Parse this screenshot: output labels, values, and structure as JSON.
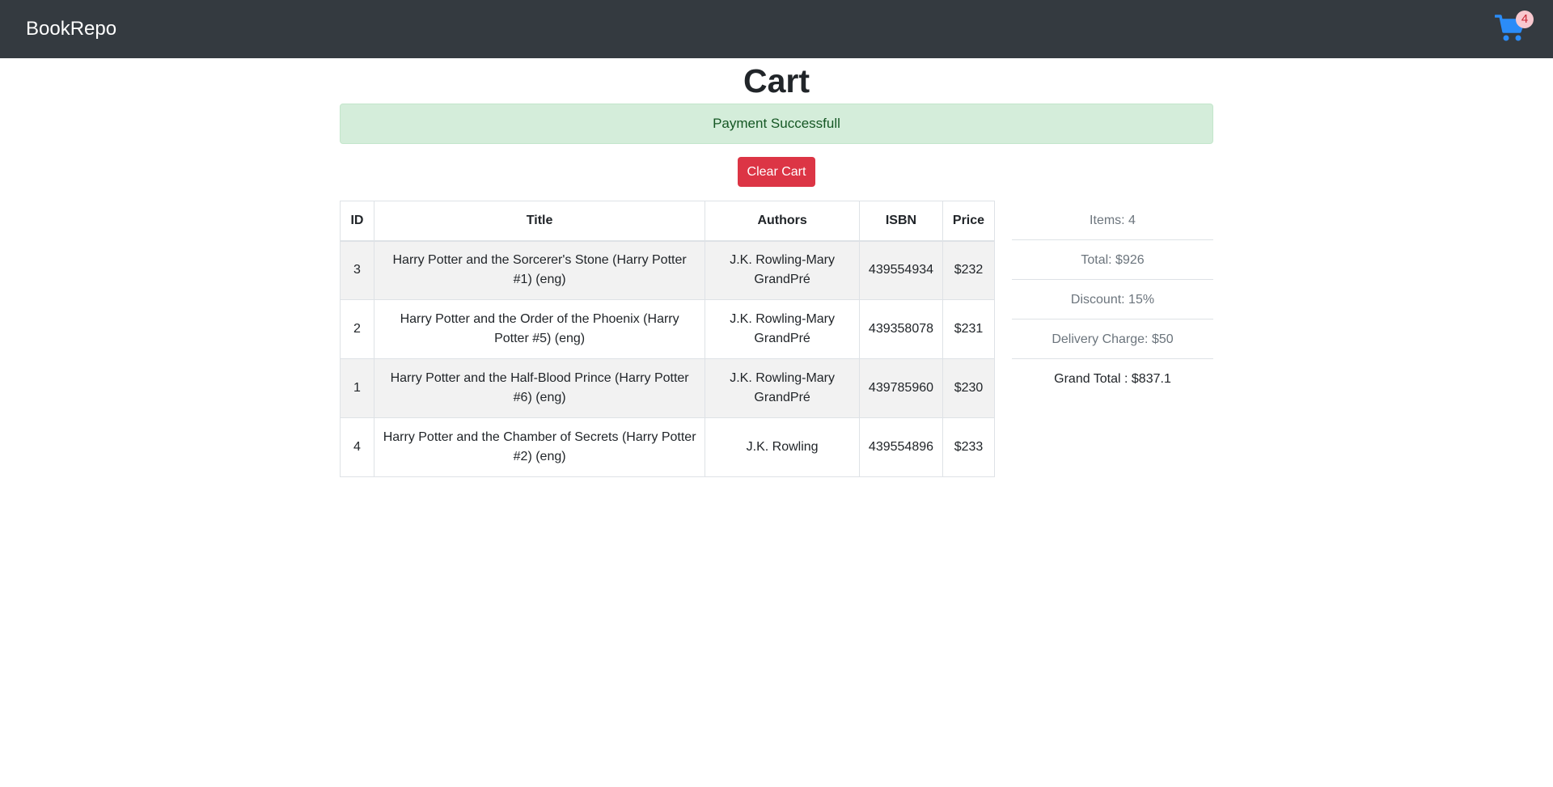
{
  "navbar": {
    "brand": "BookRepo",
    "cart_count": "4",
    "cart_icon": "shopping-cart-icon",
    "accent_color": "#2b8cf8"
  },
  "page": {
    "title": "Cart",
    "alert": "Payment Successfull",
    "clear_button": "Clear Cart"
  },
  "table": {
    "headers": {
      "id": "ID",
      "title": "Title",
      "authors": "Authors",
      "isbn": "ISBN",
      "price": "Price"
    },
    "rows": [
      {
        "id": "3",
        "title": "Harry Potter and the Sorcerer's Stone (Harry Potter #1) (eng)",
        "authors": "J.K. Rowling-Mary GrandPré",
        "isbn": "439554934",
        "price": "$232"
      },
      {
        "id": "2",
        "title": "Harry Potter and the Order of the Phoenix (Harry Potter #5) (eng)",
        "authors": "J.K. Rowling-Mary GrandPré",
        "isbn": "439358078",
        "price": "$231"
      },
      {
        "id": "1",
        "title": "Harry Potter and the Half-Blood Prince (Harry Potter #6) (eng)",
        "authors": "J.K. Rowling-Mary GrandPré",
        "isbn": "439785960",
        "price": "$230"
      },
      {
        "id": "4",
        "title": "Harry Potter and the Chamber of Secrets (Harry Potter #2) (eng)",
        "authors": "J.K. Rowling",
        "isbn": "439554896",
        "price": "$233"
      }
    ]
  },
  "summary": {
    "items": "Items: 4",
    "total": "Total: $926",
    "discount": "Discount: 15%",
    "delivery": "Delivery Charge: $50",
    "grand_total": "Grand Total : $837.1"
  }
}
